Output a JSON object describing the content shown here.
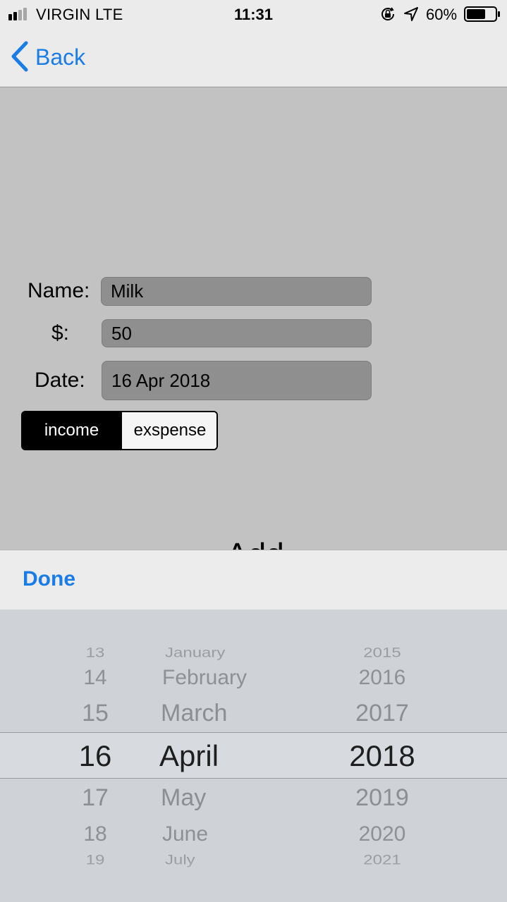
{
  "status_bar": {
    "carrier": "VIRGIN   LTE",
    "time": "11:31",
    "battery_percent": "60%",
    "signal_bars_filled": 2,
    "battery_level": 0.6
  },
  "nav": {
    "back_label": "Back"
  },
  "form": {
    "name_label": "Name:",
    "name_value": "Milk",
    "amount_label": "$:",
    "amount_value": "50",
    "date_label": "Date:",
    "date_value": "16 Apr 2018"
  },
  "type_toggle": {
    "options": [
      "income",
      "exspense"
    ],
    "selected": "income"
  },
  "add_button_label": "Add",
  "accessory": {
    "done_label": "Done"
  },
  "date_picker": {
    "selected": {
      "day": "16",
      "month": "April",
      "year": "2018"
    },
    "days": [
      "13",
      "14",
      "15",
      "16",
      "17",
      "18",
      "19"
    ],
    "months": [
      "January",
      "February",
      "March",
      "April",
      "May",
      "June",
      "July"
    ],
    "years": [
      "2015",
      "2016",
      "2017",
      "2018",
      "2019",
      "2020",
      "2021"
    ]
  },
  "colors": {
    "accent": "#1a7ce6",
    "background": "#c2c2c2",
    "field_fill": "#8f8f8f",
    "picker_background": "#cfd2d7"
  }
}
